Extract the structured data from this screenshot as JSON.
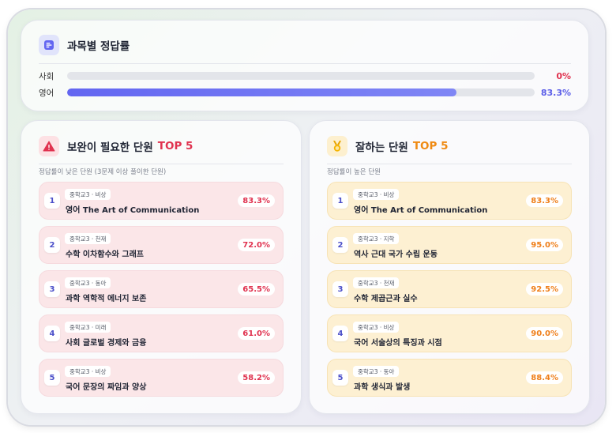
{
  "header": {
    "title": "과목별 정답률"
  },
  "subjects": [
    {
      "label": "사회",
      "percent_text": "0%",
      "percent": 0,
      "color": "#e0324f"
    },
    {
      "label": "영어",
      "percent_text": "83.3%",
      "percent": 83.3,
      "color": "#5b5ee8"
    }
  ],
  "weak": {
    "title": "보완이 필요한 단원",
    "top_label": "TOP 5",
    "top_color": "#e0324f",
    "subtitle": "정답률이 낮은 단원 (3문제 이상 풀이한 단원)",
    "items": [
      {
        "num": "1",
        "badge": "중학교3 · 비상",
        "name": "영어 The Art of Communication",
        "pct": "83.3%"
      },
      {
        "num": "2",
        "badge": "중학교3 · 천재",
        "name": "수학 이차함수와 그래프",
        "pct": "72.0%"
      },
      {
        "num": "3",
        "badge": "중학교3 · 동아",
        "name": "과학 역학적 에너지 보존",
        "pct": "65.5%"
      },
      {
        "num": "4",
        "badge": "중학교3 · 미래",
        "name": "사회 글로벌 경제와 금융",
        "pct": "61.0%"
      },
      {
        "num": "5",
        "badge": "중학교3 · 비상",
        "name": "국어 문장의 짜임과 양상",
        "pct": "58.2%"
      }
    ]
  },
  "strong": {
    "title": "잘하는 단원",
    "top_label": "TOP 5",
    "top_color": "#ef8a12",
    "subtitle": "정답률이 높은 단원",
    "items": [
      {
        "num": "1",
        "badge": "중학교3 · 비상",
        "name": "영어 The Art of Communication",
        "pct": "83.3%"
      },
      {
        "num": "2",
        "badge": "중학교3 · 지학",
        "name": "역사 근대 국가 수립 운동",
        "pct": "95.0%"
      },
      {
        "num": "3",
        "badge": "중학교3 · 천재",
        "name": "수학 제곱근과 실수",
        "pct": "92.5%"
      },
      {
        "num": "4",
        "badge": "중학교3 · 비상",
        "name": "국어 서술상의 특징과 시점",
        "pct": "90.0%"
      },
      {
        "num": "5",
        "badge": "중학교3 · 동아",
        "name": "과학 생식과 발생",
        "pct": "88.4%"
      }
    ]
  },
  "icons": {
    "header": "chart-list-icon",
    "weak": "warning-icon",
    "strong": "medal-icon"
  }
}
